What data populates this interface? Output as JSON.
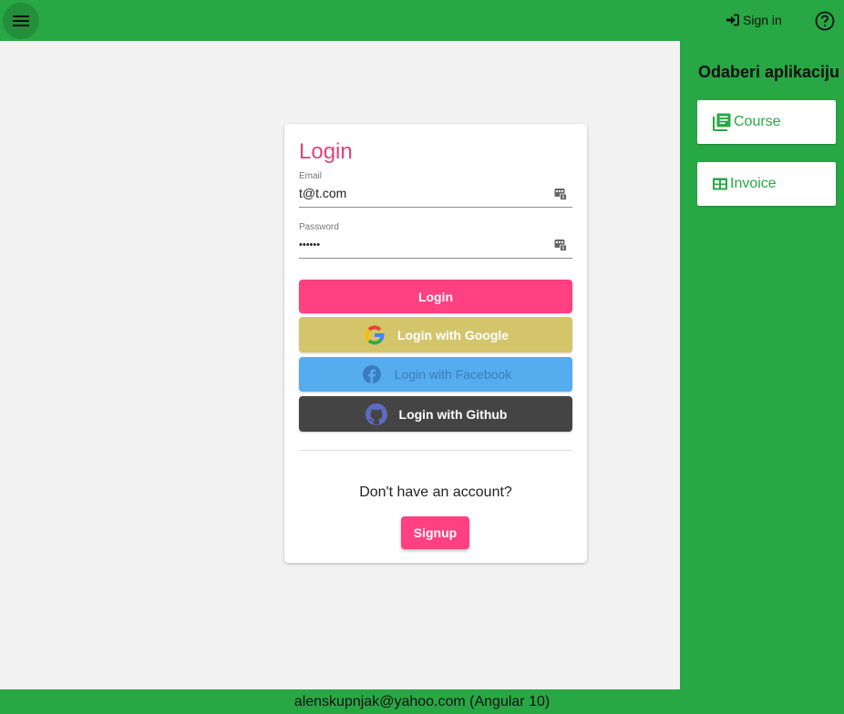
{
  "header": {
    "signin_label": "Sign in",
    "icons": [
      "menu-icon",
      "sign-in-icon",
      "help-icon"
    ]
  },
  "login": {
    "title": "Login",
    "email": {
      "label": "Email",
      "value": "t@t.com"
    },
    "password": {
      "label": "Password",
      "value": "••••••"
    },
    "login_button": "Login",
    "google_button": "Login with Google",
    "facebook_button": "Login with Facebook",
    "github_button": "Login with Github",
    "no_account_text": "Don't have an account?",
    "signup_button": "Signup"
  },
  "sidebar": {
    "title": "Odaberi aplikaciju",
    "apps": [
      {
        "label": "Course",
        "icon": "library-books-icon"
      },
      {
        "label": "Invoice",
        "icon": "table-icon"
      }
    ]
  },
  "footer": {
    "text": "alenskupnjak@yahoo.com (Angular 10)"
  },
  "colors": {
    "green": "#28a745",
    "pink": "#ff4081",
    "title_pink": "#e0457b",
    "google": "#d4c56b",
    "facebook": "#55acee",
    "github": "#444444"
  }
}
